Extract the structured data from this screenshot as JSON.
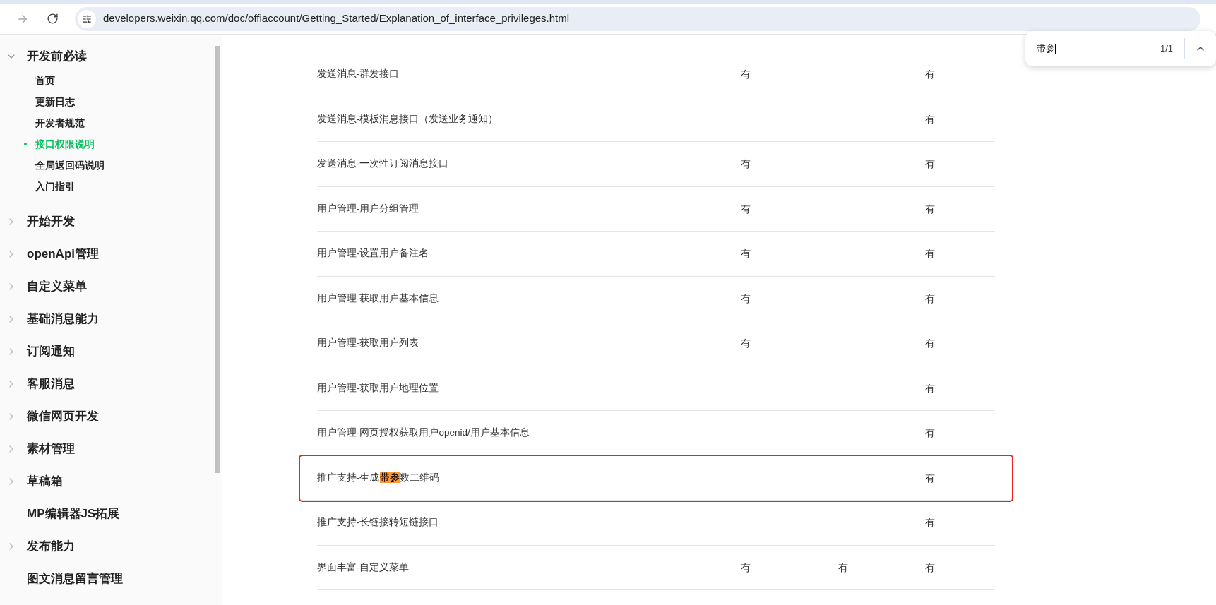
{
  "browser": {
    "forward_disabled": true,
    "url": "developers.weixin.qq.com/doc/offiaccount/Getting_Started/Explanation_of_interface_privileges.html"
  },
  "find_bar": {
    "query": "带参",
    "count": "1/1"
  },
  "sidebar": {
    "items": [
      {
        "kind": "group",
        "label": "开发前必读",
        "expanded": true,
        "children": [
          {
            "label": "首页",
            "selected": false
          },
          {
            "label": "更新日志",
            "selected": false
          },
          {
            "label": "开发者规范",
            "selected": false
          },
          {
            "label": "接口权限说明",
            "selected": true
          },
          {
            "label": "全局返回码说明",
            "selected": false
          },
          {
            "label": "入门指引",
            "selected": false
          }
        ]
      },
      {
        "kind": "group",
        "label": "开始开发",
        "expanded": false
      },
      {
        "kind": "group",
        "label": "openApi管理",
        "expanded": false
      },
      {
        "kind": "group",
        "label": "自定义菜单",
        "expanded": false
      },
      {
        "kind": "group",
        "label": "基础消息能力",
        "expanded": false
      },
      {
        "kind": "group",
        "label": "订阅通知",
        "expanded": false
      },
      {
        "kind": "group",
        "label": "客服消息",
        "expanded": false
      },
      {
        "kind": "group",
        "label": "微信网页开发",
        "expanded": false
      },
      {
        "kind": "group",
        "label": "素材管理",
        "expanded": false
      },
      {
        "kind": "group",
        "label": "草稿箱",
        "expanded": false
      },
      {
        "kind": "link",
        "label": "MP编辑器JS拓展"
      },
      {
        "kind": "group",
        "label": "发布能力",
        "expanded": false
      },
      {
        "kind": "link",
        "label": "图文消息留言管理"
      }
    ]
  },
  "table": {
    "rows": [
      {
        "name": [
          {
            "text": "发送消息-群发接口",
            "highlighted": false
          }
        ],
        "column_2": "有",
        "column_4": "有",
        "outlined": false
      },
      {
        "name": [
          {
            "text": "发送消息-模板消息接口（发送业务通知）",
            "highlighted": false
          }
        ],
        "column_4": "有",
        "outlined": false
      },
      {
        "name": [
          {
            "text": "发送消息-一次性订阅消息接口",
            "highlighted": false
          }
        ],
        "column_2": "有",
        "column_4": "有",
        "outlined": false
      },
      {
        "name": [
          {
            "text": "用户管理-用户分组管理",
            "highlighted": false
          }
        ],
        "column_2": "有",
        "column_4": "有",
        "outlined": false
      },
      {
        "name": [
          {
            "text": "用户管理-设置用户备注名",
            "highlighted": false
          }
        ],
        "column_2": "有",
        "column_4": "有",
        "outlined": false
      },
      {
        "name": [
          {
            "text": "用户管理-获取用户基本信息",
            "highlighted": false
          }
        ],
        "column_2": "有",
        "column_4": "有",
        "outlined": false
      },
      {
        "name": [
          {
            "text": "用户管理-获取用户列表",
            "highlighted": false
          }
        ],
        "column_2": "有",
        "column_4": "有",
        "outlined": false
      },
      {
        "name": [
          {
            "text": "用户管理-获取用户地理位置",
            "highlighted": false
          }
        ],
        "column_4": "有",
        "outlined": false
      },
      {
        "name": [
          {
            "text": "用户管理-网页授权获取用户openid/用户基本信息",
            "highlighted": false
          }
        ],
        "column_4": "有",
        "outlined": false
      },
      {
        "name": [
          {
            "text": "推广支持-生成",
            "highlighted": false
          },
          {
            "text": "带参",
            "highlighted": true
          },
          {
            "text": "数二维码",
            "highlighted": false
          }
        ],
        "column_4": "有",
        "outlined": true
      },
      {
        "name": [
          {
            "text": "推广支持-长链接转短链接口",
            "highlighted": false
          }
        ],
        "column_4": "有",
        "outlined": false
      },
      {
        "name": [
          {
            "text": "界面丰富-自定义菜单",
            "highlighted": false
          }
        ],
        "column_2": "有",
        "column_3": "有",
        "column_4": "有",
        "outlined": false
      }
    ]
  }
}
